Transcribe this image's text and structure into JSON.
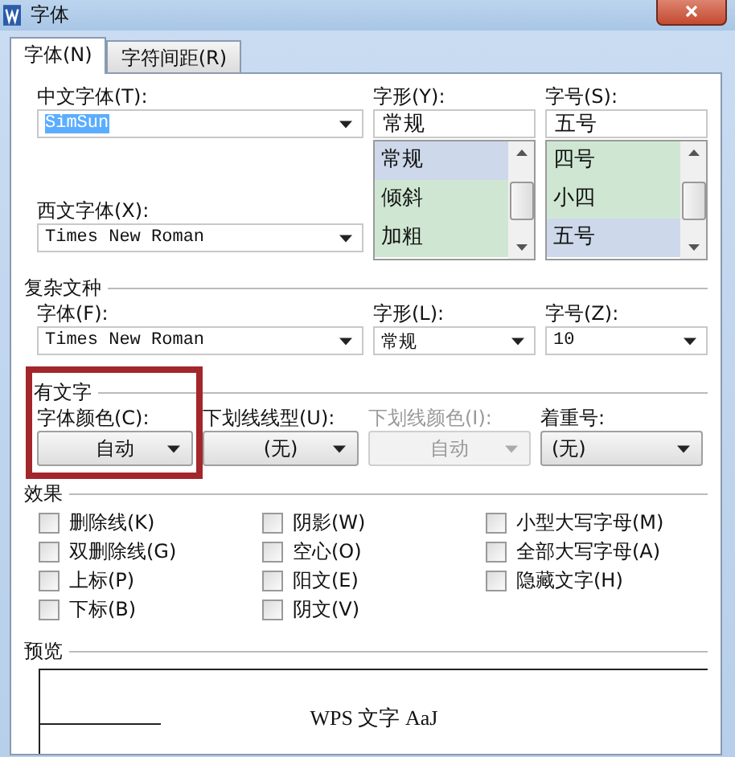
{
  "window": {
    "title": "字体"
  },
  "tabs": [
    {
      "label": "字体(N)",
      "selected": true
    },
    {
      "label": "字符间距(R)",
      "selected": false
    }
  ],
  "main": {
    "chinese_font": {
      "label": "中文字体(T):",
      "value": "SimSun",
      "text_selected": true
    },
    "western_font": {
      "label": "西文字体(X):",
      "value": "Times New Roman"
    },
    "style": {
      "label": "字形(Y):",
      "value": "常规",
      "options": [
        {
          "text": "常规",
          "selected": true
        },
        {
          "text": "倾斜",
          "selected": false
        },
        {
          "text": "加粗",
          "selected": false
        }
      ]
    },
    "size": {
      "label": "字号(S):",
      "value": "五号",
      "options": [
        {
          "text": "四号",
          "selected": false
        },
        {
          "text": "小四",
          "selected": false
        },
        {
          "text": "五号",
          "selected": true
        }
      ]
    }
  },
  "complex": {
    "title": "复杂文种",
    "fields": [
      {
        "label": "字体(F):",
        "value": "Times New Roman"
      },
      {
        "label": "字形(L):",
        "value": "常规"
      },
      {
        "label": "字号(Z):",
        "value": "10"
      }
    ]
  },
  "all_text": {
    "title": "有文字",
    "controls": [
      {
        "label": "字体颜色(C):",
        "value": "自动",
        "disabled": false,
        "highlighted": true
      },
      {
        "label": "下划线线型(U):",
        "value": "(无)",
        "disabled": false,
        "highlighted": false
      },
      {
        "label": "下划线颜色(I):",
        "value": "自动",
        "disabled": true,
        "highlighted": false
      },
      {
        "label": "着重号:",
        "value": "(无)",
        "disabled": false,
        "highlighted": false
      }
    ]
  },
  "effects": {
    "title": "效果",
    "options": [
      {
        "label": "删除线(K)",
        "checked": false
      },
      {
        "label": "阴影(W)",
        "checked": false
      },
      {
        "label": "小型大写字母(M)",
        "checked": false
      },
      {
        "label": "双删除线(G)",
        "checked": false
      },
      {
        "label": "空心(O)",
        "checked": false
      },
      {
        "label": "全部大写字母(A)",
        "checked": false
      },
      {
        "label": "上标(P)",
        "checked": false
      },
      {
        "label": "阳文(E)",
        "checked": false
      },
      {
        "label": "隐藏文字(H)",
        "checked": false
      },
      {
        "label": "下标(B)",
        "checked": false
      },
      {
        "label": "阴文(V)",
        "checked": false
      }
    ]
  },
  "preview": {
    "title": "预览",
    "sample": "WPS 文字 AaJ"
  }
}
